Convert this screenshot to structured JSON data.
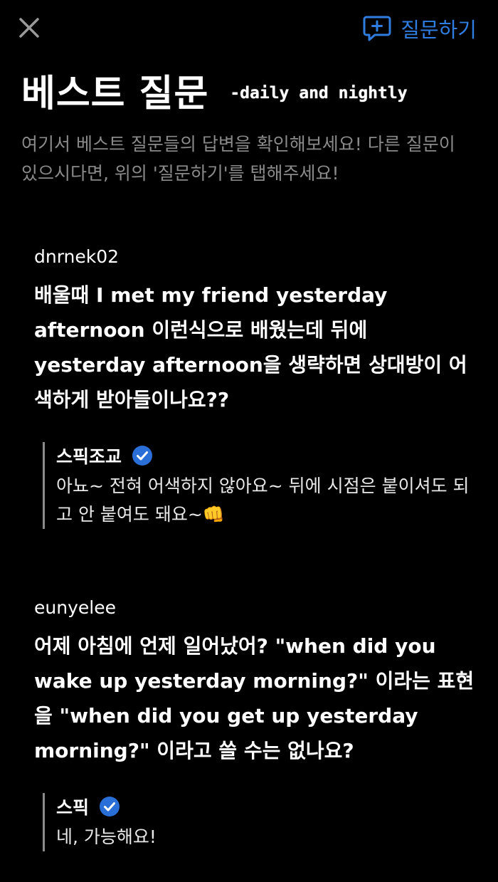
{
  "topbar": {
    "close_icon": "close-icon",
    "ask_icon": "chat-plus-icon",
    "ask_label": "질문하기"
  },
  "header": {
    "title": "베스트 질문",
    "subtitle": "-daily and nightly"
  },
  "intro": "여기서 베스트 질문들의 답변을 확인해보세요! 다른 질문이 있으시다면, 위의 '질문하기'를 탭해주세요!",
  "posts": [
    {
      "user": "dnrnek02",
      "question": "배울때 I met my friend yesterday afternoon 이런식으로 배웠는데 뒤에 yesterday afternoon을 생략하면 상대방이 어색하게 받아들이나요??",
      "answer": {
        "name": "스픽조교",
        "verified_icon": "verified-check-icon",
        "text": "아뇨~ 전혀 어색하지 않아요~ 뒤에 시점은 붙이셔도 되고 안 붙여도 돼요~👊"
      }
    },
    {
      "user": "eunyelee",
      "question": "어제 아침에 언제 일어났어? \"when did you wake up yesterday morning?\" 이라는 표현을 \"when did you get up yesterday morning?\" 이라고 쓸 수는 없나요?",
      "answer": {
        "name": "스픽",
        "verified_icon": "verified-check-icon",
        "text": "네, 가능해요!"
      }
    }
  ],
  "colors": {
    "background": "#000000",
    "accent": "#2f7de1",
    "muted_text": "#8a8a8a",
    "verified_badge": "#2a6fd8"
  }
}
